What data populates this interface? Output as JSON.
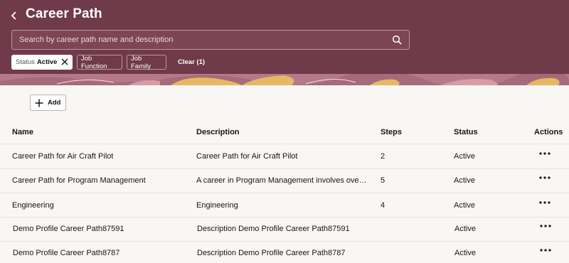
{
  "header": {
    "title": "Career Path",
    "back_icon": "chevron-left-icon"
  },
  "search": {
    "placeholder": "Search by career path name and description",
    "icon": "search-icon"
  },
  "filters": {
    "status_label": "Status",
    "status_value": "Active",
    "job_function": "Job Function",
    "job_family": "Job Family",
    "clear": "Clear (1)"
  },
  "toolbar": {
    "add_label": "Add"
  },
  "table": {
    "columns": [
      "Name",
      "Description",
      "Steps",
      "Status",
      "Actions"
    ],
    "rows": [
      {
        "name": "Career Path for Air Craft Pilot",
        "description": "Career Path for Air Craft Pilot",
        "steps": "2",
        "status": "Active"
      },
      {
        "name": "Career Path for Program Management",
        "description": "A career in Program Management involves overs…",
        "steps": "5",
        "status": "Active"
      },
      {
        "name": "Engineering",
        "description": "Engineering",
        "steps": "4",
        "status": "Active"
      },
      {
        "name": "Demo Profile Career Path87591",
        "description": "Description Demo Profile Career Path87591",
        "steps": "",
        "status": "Active"
      },
      {
        "name": "Demo Profile Career Path8787",
        "description": "Description Demo Profile Career Path8787",
        "steps": "",
        "status": "Active"
      }
    ]
  },
  "colors": {
    "header_bg": "#6f3a4a",
    "page_bg": "#f9f7f4"
  }
}
